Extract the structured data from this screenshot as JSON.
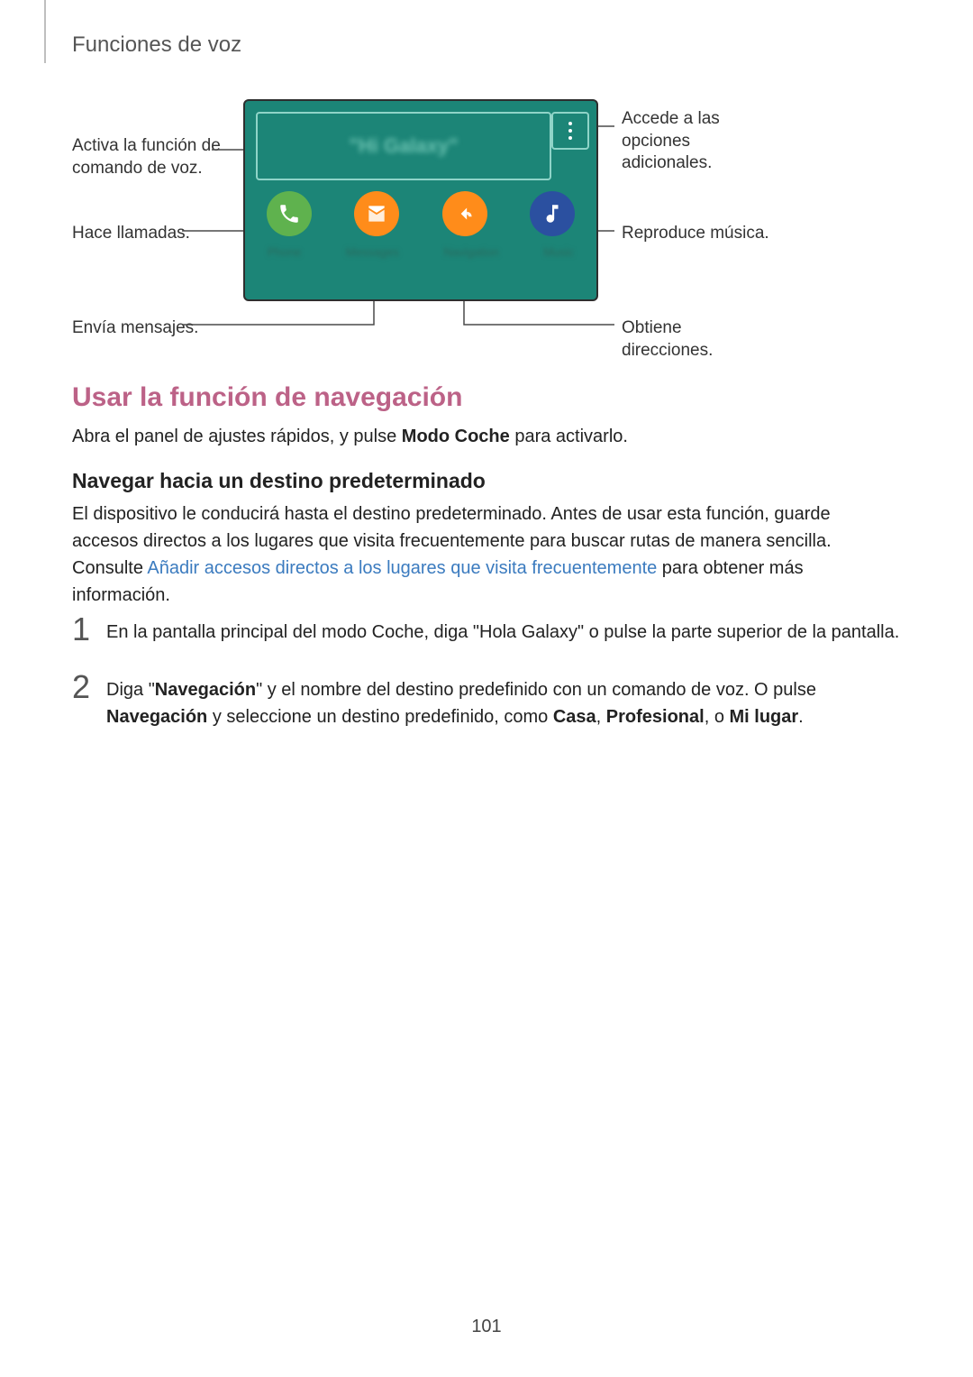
{
  "header": {
    "title": "Funciones de voz"
  },
  "diagram": {
    "screen_hint": "\"Hi Galaxy\"",
    "app_labels": {
      "phone": "Phone",
      "messages": "Messages",
      "navigation": "Navigation",
      "music": "Music"
    },
    "callouts": {
      "voice": "Activa la función de comando de voz.",
      "options": "Accede a las opciones adicionales.",
      "calls": "Hace llamadas.",
      "music": "Reproduce música.",
      "msg": "Envía mensajes.",
      "dir": "Obtiene direcciones."
    }
  },
  "h2": "Usar la función de navegación",
  "p1_a": "Abra el panel de ajustes rápidos, y pulse ",
  "p1_b": "Modo Coche",
  "p1_c": " para activarlo.",
  "h3": "Navegar hacia un destino predeterminado",
  "p2_a": "El dispositivo le conducirá hasta el destino predeterminado. Antes de usar esta función, guarde accesos directos a los lugares que visita frecuentemente para buscar rutas de manera sencilla. Consulte ",
  "p2_link": "Añadir accesos directos a los lugares que visita frecuentemente",
  "p2_b": " para obtener más información.",
  "steps": {
    "s1": {
      "num": "1",
      "text": "En la pantalla principal del modo Coche, diga \"Hola Galaxy\" o pulse la parte superior de la pantalla."
    },
    "s2": {
      "num": "2",
      "a": "Diga \"",
      "b": "Navegación",
      "c": "\" y el nombre del destino predefinido con un comando de voz. O pulse ",
      "d": "Navegación",
      "e": " y seleccione un destino predefinido, como ",
      "f": "Casa",
      "g": ", ",
      "h": "Profesional",
      "i": ", o ",
      "j": "Mi lugar",
      "k": "."
    }
  },
  "page_number": "101"
}
